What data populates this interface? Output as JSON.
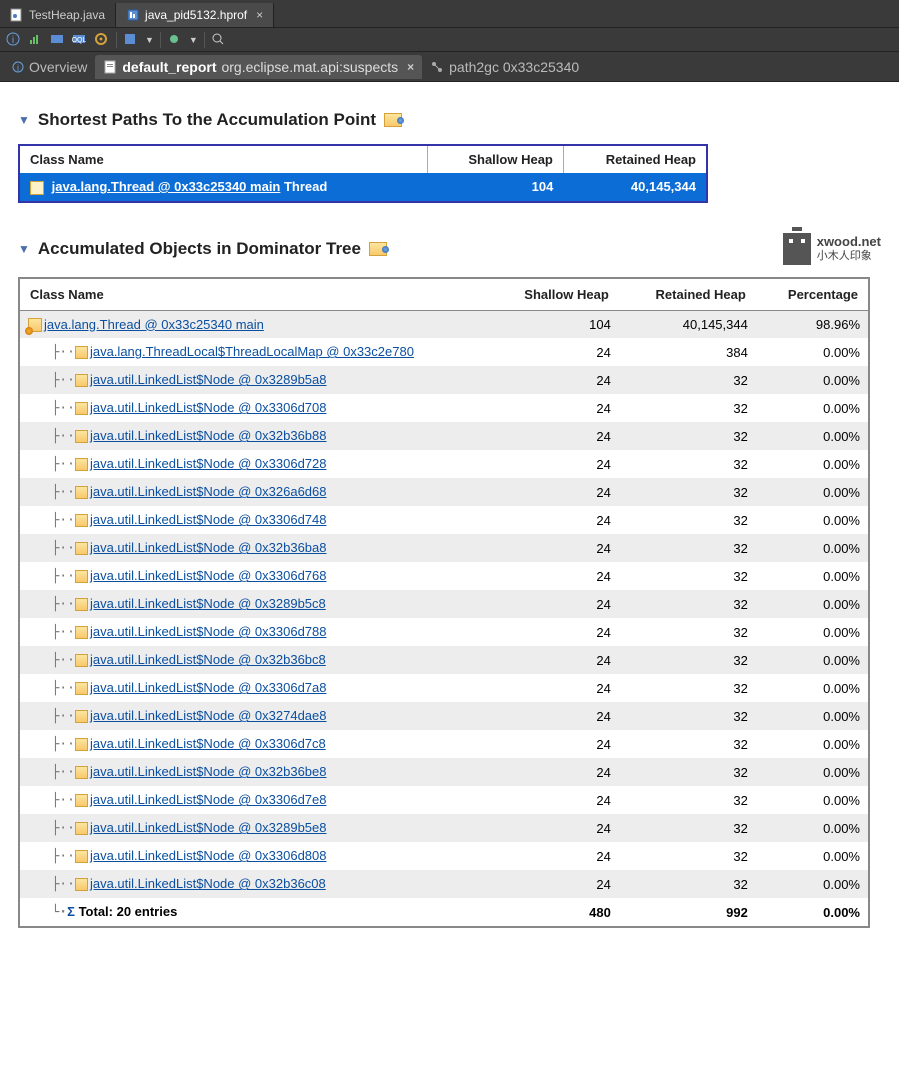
{
  "tabs_top": [
    {
      "label": "TestHeap.java",
      "active": false,
      "icon": "java-file-icon"
    },
    {
      "label": "java_pid5132.hprof",
      "active": true,
      "icon": "hprof-file-icon"
    }
  ],
  "tabs_sub": [
    {
      "label": "Overview",
      "active": false
    },
    {
      "bold": "default_report",
      "rest": "org.eclipse.mat.api:suspects",
      "active": true,
      "closable": true
    },
    {
      "rest": "path2gc  0x33c25340",
      "active": false
    }
  ],
  "section1": {
    "title": "Shortest Paths To the Accumulation Point",
    "columns": [
      "Class Name",
      "Shallow Heap",
      "Retained Heap"
    ],
    "row": {
      "link": "java.lang.Thread @ 0x33c25340 main",
      "tail": " Thread",
      "shallow": "104",
      "retained": "40,145,344"
    }
  },
  "section2": {
    "title": "Accumulated Objects in Dominator Tree",
    "logo": {
      "line1": "xwood.net",
      "line2": "小木人印象"
    },
    "columns": [
      "Class Name",
      "Shallow Heap",
      "Retained Heap",
      "Percentage"
    ],
    "root": {
      "link": "java.lang.Thread @ 0x33c25340 main",
      "shallow": "104",
      "retained": "40,145,344",
      "pct": "98.96%"
    },
    "children": [
      {
        "link": "java.lang.ThreadLocal$ThreadLocalMap @ 0x33c2e780",
        "shallow": "24",
        "retained": "384",
        "pct": "0.00%"
      },
      {
        "link": "java.util.LinkedList$Node @ 0x3289b5a8",
        "shallow": "24",
        "retained": "32",
        "pct": "0.00%"
      },
      {
        "link": "java.util.LinkedList$Node @ 0x3306d708",
        "shallow": "24",
        "retained": "32",
        "pct": "0.00%"
      },
      {
        "link": "java.util.LinkedList$Node @ 0x32b36b88",
        "shallow": "24",
        "retained": "32",
        "pct": "0.00%"
      },
      {
        "link": "java.util.LinkedList$Node @ 0x3306d728",
        "shallow": "24",
        "retained": "32",
        "pct": "0.00%"
      },
      {
        "link": "java.util.LinkedList$Node @ 0x326a6d68",
        "shallow": "24",
        "retained": "32",
        "pct": "0.00%"
      },
      {
        "link": "java.util.LinkedList$Node @ 0x3306d748",
        "shallow": "24",
        "retained": "32",
        "pct": "0.00%"
      },
      {
        "link": "java.util.LinkedList$Node @ 0x32b36ba8",
        "shallow": "24",
        "retained": "32",
        "pct": "0.00%"
      },
      {
        "link": "java.util.LinkedList$Node @ 0x3306d768",
        "shallow": "24",
        "retained": "32",
        "pct": "0.00%"
      },
      {
        "link": "java.util.LinkedList$Node @ 0x3289b5c8",
        "shallow": "24",
        "retained": "32",
        "pct": "0.00%"
      },
      {
        "link": "java.util.LinkedList$Node @ 0x3306d788",
        "shallow": "24",
        "retained": "32",
        "pct": "0.00%"
      },
      {
        "link": "java.util.LinkedList$Node @ 0x32b36bc8",
        "shallow": "24",
        "retained": "32",
        "pct": "0.00%"
      },
      {
        "link": "java.util.LinkedList$Node @ 0x3306d7a8",
        "shallow": "24",
        "retained": "32",
        "pct": "0.00%"
      },
      {
        "link": "java.util.LinkedList$Node @ 0x3274dae8",
        "shallow": "24",
        "retained": "32",
        "pct": "0.00%"
      },
      {
        "link": "java.util.LinkedList$Node @ 0x3306d7c8",
        "shallow": "24",
        "retained": "32",
        "pct": "0.00%"
      },
      {
        "link": "java.util.LinkedList$Node @ 0x32b36be8",
        "shallow": "24",
        "retained": "32",
        "pct": "0.00%"
      },
      {
        "link": "java.util.LinkedList$Node @ 0x3306d7e8",
        "shallow": "24",
        "retained": "32",
        "pct": "0.00%"
      },
      {
        "link": "java.util.LinkedList$Node @ 0x3289b5e8",
        "shallow": "24",
        "retained": "32",
        "pct": "0.00%"
      },
      {
        "link": "java.util.LinkedList$Node @ 0x3306d808",
        "shallow": "24",
        "retained": "32",
        "pct": "0.00%"
      },
      {
        "link": "java.util.LinkedList$Node @ 0x32b36c08",
        "shallow": "24",
        "retained": "32",
        "pct": "0.00%"
      }
    ],
    "total": {
      "label": "Total: 20 entries",
      "shallow": "480",
      "retained": "992",
      "pct": "0.00%"
    }
  }
}
